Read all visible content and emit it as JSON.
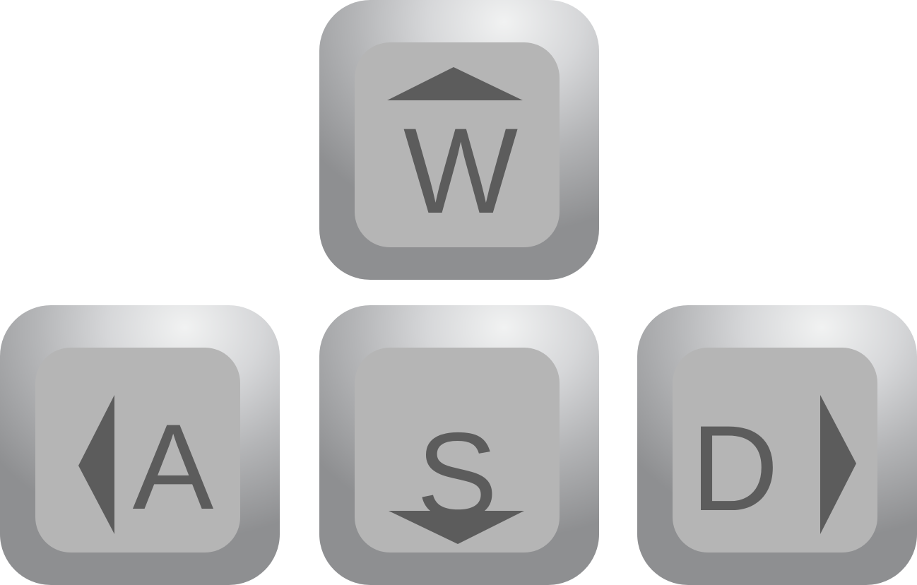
{
  "keys": {
    "w": {
      "label": "W",
      "arrow": "up-arrow-icon"
    },
    "a": {
      "label": "A",
      "arrow": "left-arrow-icon"
    },
    "s": {
      "label": "S",
      "arrow": "down-arrow-icon"
    },
    "d": {
      "label": "D",
      "arrow": "right-arrow-icon"
    }
  },
  "colors": {
    "background": "#ffffff",
    "key_face": "#b5b5b5",
    "key_edge_light": "#f1f2f2",
    "key_edge_dark": "#8e8f91",
    "glyph": "#5c5c5c"
  }
}
